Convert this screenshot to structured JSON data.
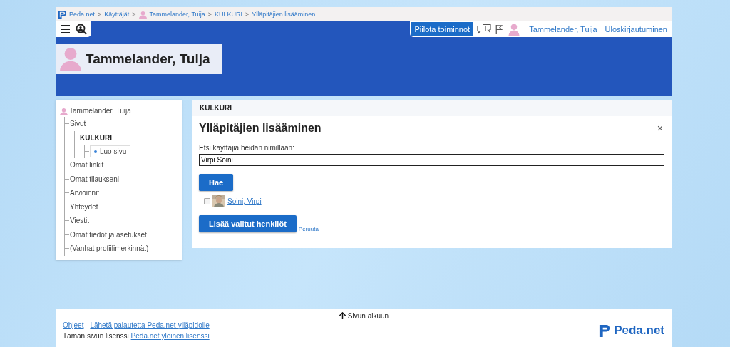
{
  "breadcrumb": [
    {
      "kind": "home",
      "label": "Peda.net"
    },
    {
      "kind": "separator",
      "label": ">"
    },
    {
      "kind": "link",
      "label": "Käyttäjät"
    },
    {
      "kind": "separator",
      "label": ">"
    },
    {
      "kind": "user",
      "label": "Tammelander, Tuija"
    },
    {
      "kind": "separator",
      "label": ">"
    },
    {
      "kind": "link",
      "label": "KULKURI"
    },
    {
      "kind": "separator",
      "label": ">"
    },
    {
      "kind": "link",
      "label": "Ylläpitäjien lisääminen"
    }
  ],
  "toolbar": {
    "hide_button": "Piilota toiminnot",
    "user": "Tammelander, Tuija",
    "logout": "Uloskirjautuminen"
  },
  "profile": {
    "name": "Tammelander, Tuija"
  },
  "tree": {
    "label": "Tammelander, Tuija",
    "children": [
      {
        "label": "Sivut",
        "selected": false,
        "children": [
          {
            "label": "KULKURI",
            "selected": true,
            "children": [
              {
                "label": "Luo sivu",
                "kind": "create"
              }
            ]
          }
        ]
      },
      {
        "label": "Omat linkit",
        "selected": false
      },
      {
        "label": "Omat tilaukseni",
        "selected": false
      },
      {
        "label": "Arvioinnit",
        "selected": false
      },
      {
        "label": "Yhteydet",
        "selected": false
      },
      {
        "label": "Viestit",
        "selected": false
      },
      {
        "label": "Omat tiedot ja asetukset",
        "selected": false
      },
      {
        "label": "(Vanhat profiilimerkinnät)",
        "selected": false
      }
    ]
  },
  "panel": {
    "header": "KULKURI"
  },
  "dialog": {
    "title": "Ylläpitäjien lisääminen",
    "close": "×",
    "search_label": "Etsi käyttäjiä heidän nimillään:",
    "search_value": "Virpi Soini",
    "search_button": "Hae",
    "results": [
      {
        "name": "Soini, Virpi",
        "checked": false
      }
    ],
    "add_button": "Lisää valitut henkilöt",
    "cancel": "Peruuta"
  },
  "footer": {
    "top_link": "Sivun alkuun",
    "help": "Ohjeet",
    "dash": "-",
    "feedback": "Lähetä palautetta Peda.net-ylläpidolle",
    "license_text": "Tämän sivun lisenssi",
    "license_link": "Peda.net yleinen lisenssi",
    "logo": "Peda.net"
  }
}
